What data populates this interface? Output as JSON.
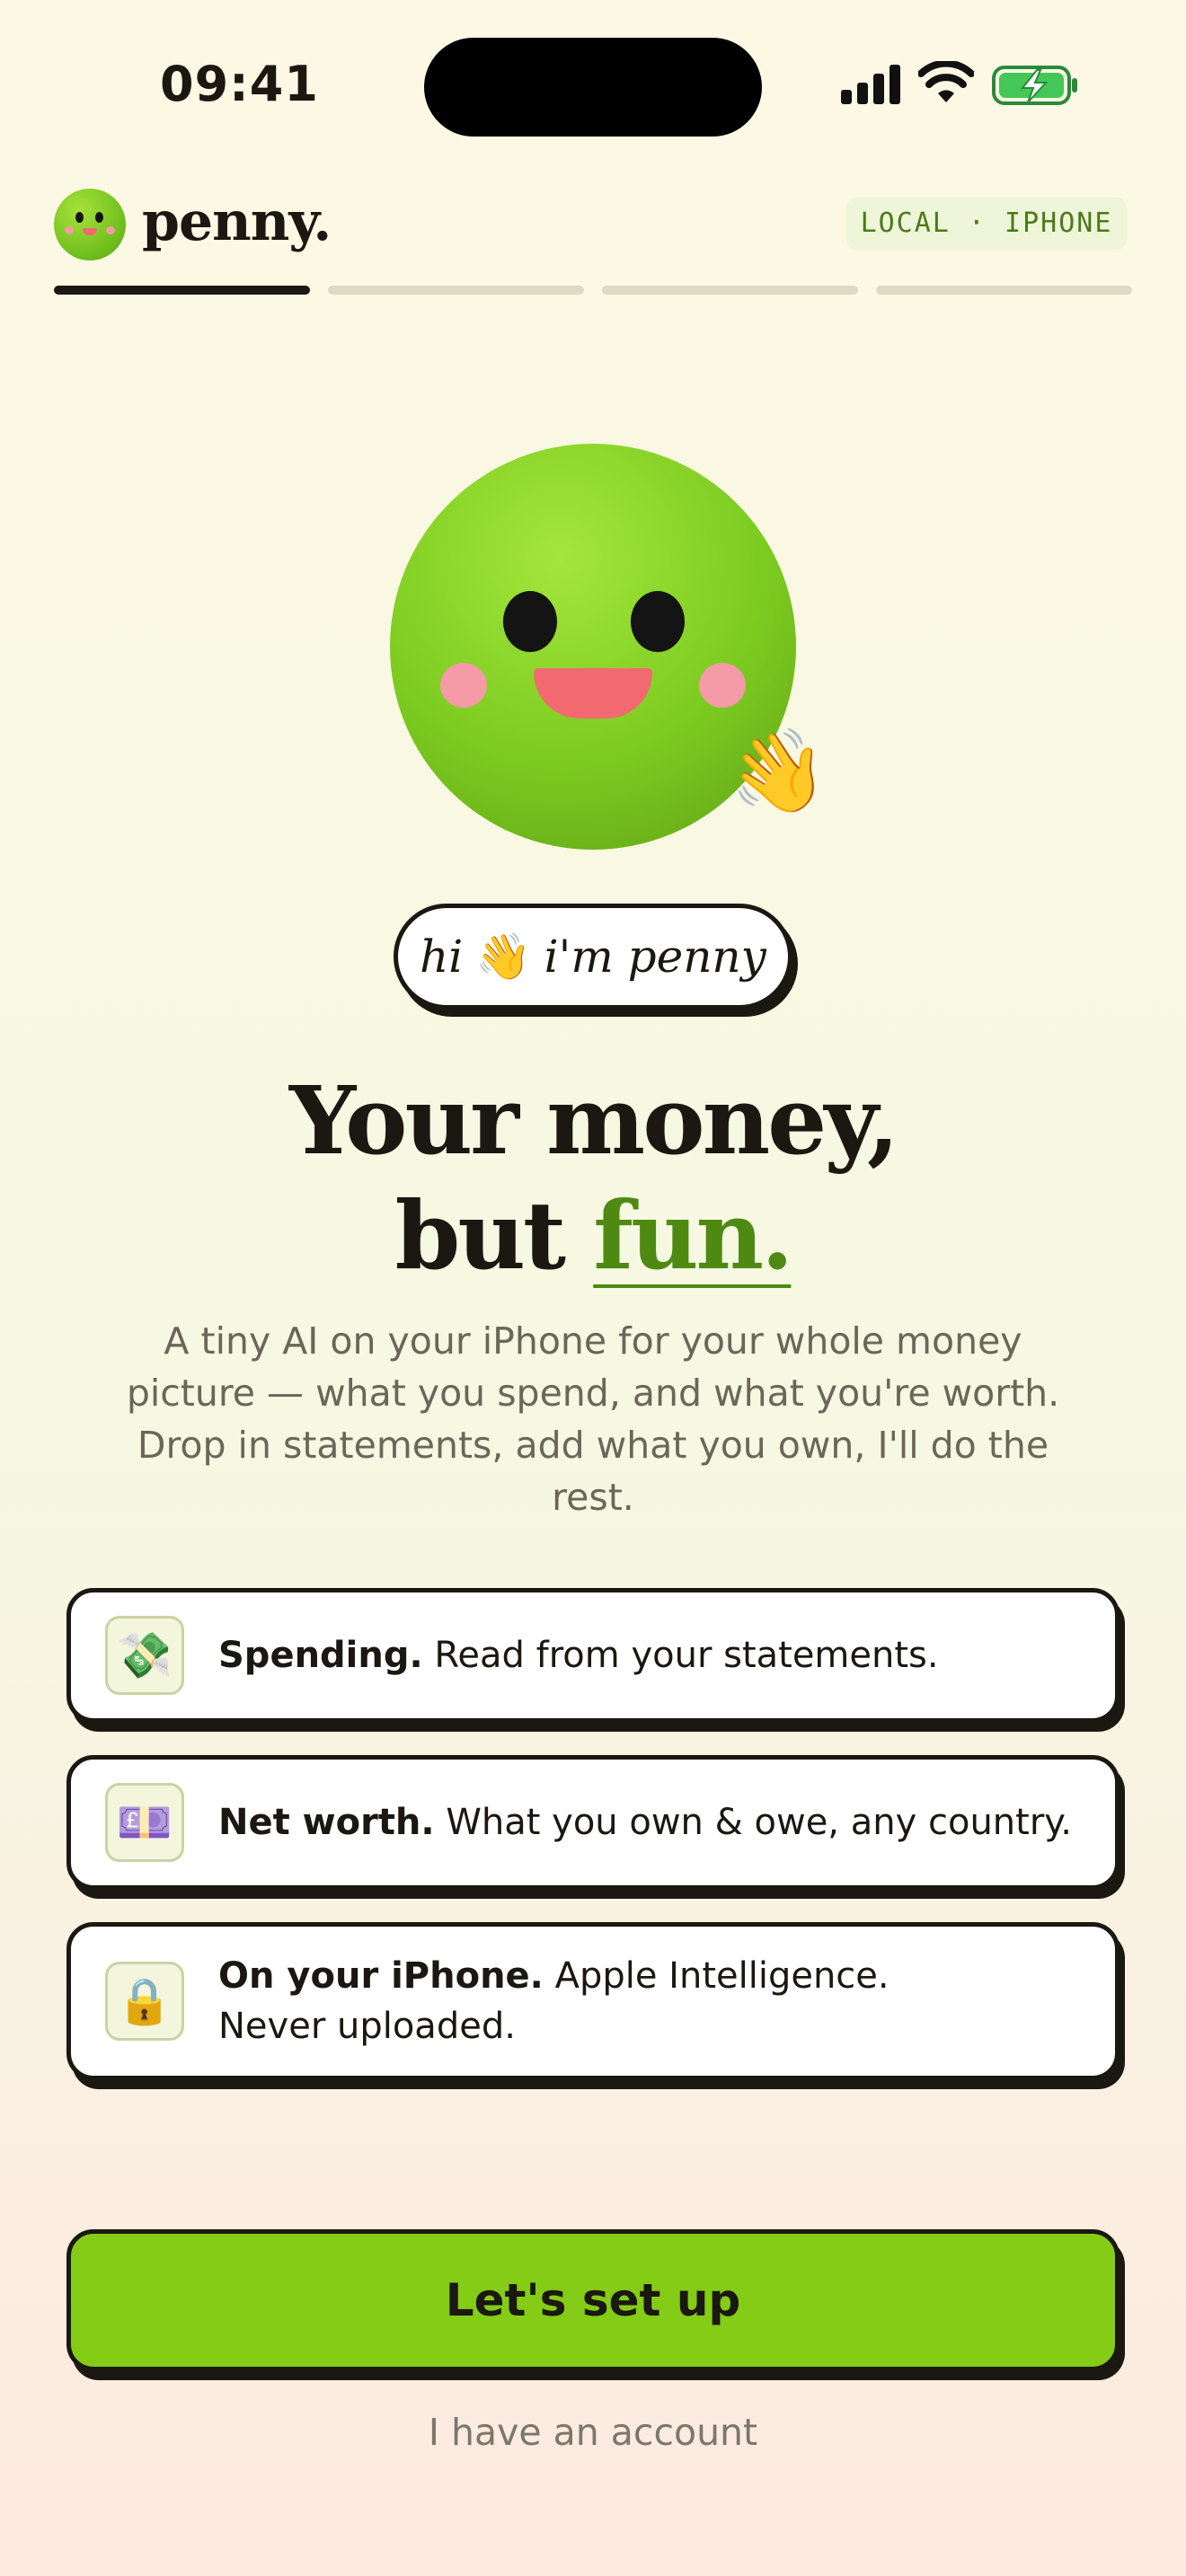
{
  "status_bar": {
    "time": "09:41"
  },
  "header": {
    "brand": "penny.",
    "locale": "LOCAL · IPHONE",
    "progress": {
      "current_step": 1,
      "total_steps": 4
    }
  },
  "hero": {
    "greeting_hi": "hi",
    "greeting_emoji": "👋",
    "greeting_rest": "i'm penny",
    "wave_emoji": "👋",
    "headline_line1": "Your money,",
    "headline_line2_plain": "but",
    "headline_line2_accent": "fun.",
    "subtitle": "A tiny AI on your iPhone for your whole money picture — what you spend, and what you're worth. Drop in statements, add what you own, I'll do the rest."
  },
  "features": [
    {
      "icon": "💸",
      "icon_name": "money-with-wings-icon",
      "title": "Spending.",
      "desc": "Read from your statements."
    },
    {
      "icon": "💷",
      "icon_name": "pound-banknote-icon",
      "title": "Net worth.",
      "desc": "What you own & owe, any country."
    },
    {
      "icon": "🔒",
      "icon_name": "lock-icon",
      "title": "On your iPhone.",
      "desc": "Apple Intelligence.",
      "desc2": "Never uploaded."
    }
  ],
  "actions": {
    "primary": "Let's set up",
    "secondary": "I have an account"
  },
  "colors": {
    "accent": "#84cc16",
    "ink": "#1b1711",
    "accent_dark": "#4e8a12"
  }
}
